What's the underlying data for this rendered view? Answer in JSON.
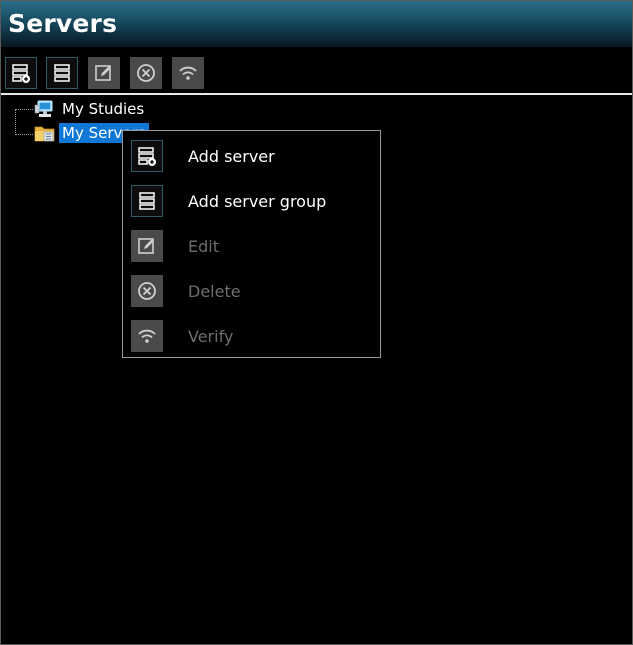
{
  "window": {
    "title": "Servers"
  },
  "toolbar": {
    "buttons": [
      {
        "name": "add-server",
        "icon": "add-server-icon",
        "enabled": true
      },
      {
        "name": "add-server-group",
        "icon": "server-group-icon",
        "enabled": true
      },
      {
        "name": "edit",
        "icon": "edit-icon",
        "enabled": false
      },
      {
        "name": "delete",
        "icon": "delete-icon",
        "enabled": false
      },
      {
        "name": "verify",
        "icon": "wifi-icon",
        "enabled": false
      }
    ]
  },
  "tree": {
    "items": [
      {
        "label": "My Studies",
        "icon": "computer-icon",
        "selected": false
      },
      {
        "label": "My Servers",
        "icon": "folder-icon",
        "selected": true
      }
    ]
  },
  "context_menu": {
    "items": [
      {
        "label": "Add server",
        "icon": "add-server-icon",
        "enabled": true
      },
      {
        "label": "Add server group",
        "icon": "server-group-icon",
        "enabled": true
      },
      {
        "label": "Edit",
        "icon": "edit-icon",
        "enabled": false
      },
      {
        "label": "Delete",
        "icon": "delete-icon",
        "enabled": false
      },
      {
        "label": "Verify",
        "icon": "wifi-icon",
        "enabled": false
      }
    ]
  },
  "colors": {
    "selection": "#0f78d7",
    "disabled_text": "#6e6e6e",
    "title_gradient_top": "#2a6f89"
  }
}
